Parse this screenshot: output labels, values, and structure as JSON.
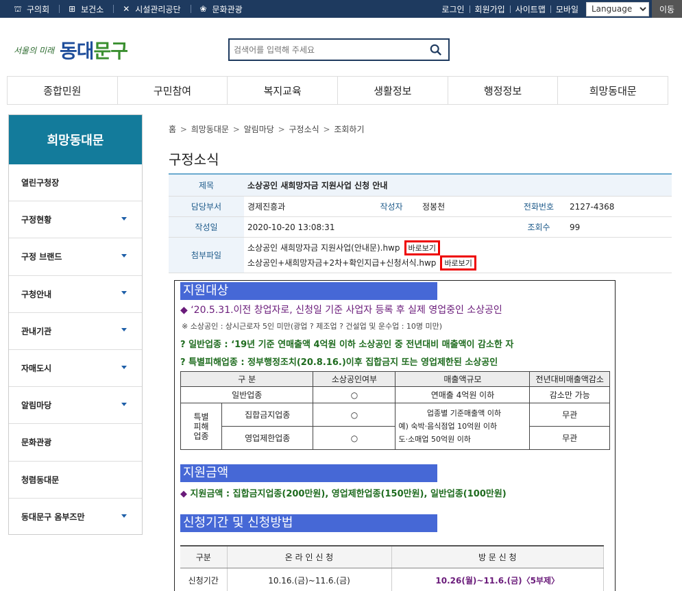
{
  "topbar": {
    "links": [
      {
        "icon": "council-icon",
        "label": "구의회"
      },
      {
        "icon": "health-center-icon",
        "label": "보건소"
      },
      {
        "icon": "facility-tools-icon",
        "label": "시설관리공단"
      },
      {
        "icon": "culture-hall-icon",
        "label": "문화관광"
      }
    ],
    "right_links": [
      "로그인",
      "회원가입",
      "사이트맵",
      "모바일"
    ],
    "language_select": "Language",
    "go_button": "이동"
  },
  "logo": {
    "small": "서울의 미래",
    "big_1": "동대",
    "big_2": "문구"
  },
  "search": {
    "placeholder": "검색어를 입력해 주세요"
  },
  "gnb": [
    "종합민원",
    "구민참여",
    "복지교육",
    "생활정보",
    "행정정보",
    "희망동대문"
  ],
  "lnb": {
    "title": "희망동대문",
    "items": [
      {
        "label": "열린구청장",
        "arrow": false
      },
      {
        "label": "구정현황",
        "arrow": true
      },
      {
        "label": "구정 브랜드",
        "arrow": true
      },
      {
        "label": "구청안내",
        "arrow": true
      },
      {
        "label": "관내기관",
        "arrow": true
      },
      {
        "label": "자매도시",
        "arrow": true
      },
      {
        "label": "알림마당",
        "arrow": true
      },
      {
        "label": "문화관광",
        "arrow": false
      },
      {
        "label": "청렴동대문",
        "arrow": false
      },
      {
        "label": "동대문구 옴부즈만",
        "arrow": true
      }
    ]
  },
  "breadcrumb": [
    "홈",
    "희망동대문",
    "알림마당",
    "구정소식",
    "조회하기"
  ],
  "page_title": "구정소식",
  "post": {
    "title_label": "제목",
    "title": "소상공인 새희망자금 지원사업 신청 안내",
    "dept_label": "담당부서",
    "dept": "경제진흥과",
    "author_label": "작성자",
    "author": "정봉천",
    "phone_label": "전화번호",
    "phone": "2127-4368",
    "date_label": "작성일",
    "date": "2020-10-20 13:08:31",
    "views_label": "조회수",
    "views": "99",
    "files_label": "첨부파일",
    "files": [
      {
        "name": "소상공인 새희망자금 지원사업(안내문).hwp",
        "view": "바로보기"
      },
      {
        "name": "소상공인+새희망자금+2차+확인지급+신청서식.hwp",
        "view": "바로보기"
      }
    ]
  },
  "doc": {
    "sec1": "지원대상",
    "bullet1": "◆ ‘20.5.31.이전 창업자로, 신청일 기준 사업자 등록 후 실제 영업중인 소상공인",
    "note1": "※ 소상공인 : 상시근로자 5인 미만(광업 ? 제조업 ? 건설업 및 운수업 : 10명 미만)",
    "item1": "?  일반업종 : ‘19년 기준 연매출액 4억원 이하 소상공인 중 전년대비 매출액이 감소한 자",
    "item2": "?  특별피해업종 : 정부행정조치(20.8.16.)이후 집합금지 또는 영업제한된 소상공인",
    "table1": {
      "headers": [
        "구 분",
        "소상공인여부",
        "매출액규모",
        "전년대비매출액감소"
      ],
      "row1": [
        "일반업종",
        "○",
        "연매출 4억원 이하",
        "감소만 가능"
      ],
      "special_label": "특별\n피해\n업종",
      "row2_sub": "집합금지업종",
      "row2_check": "○",
      "row2_sales_1": "업종별 기준매출액 이하",
      "row2_sales_2": "예) 숙박·음식점업 10억원 이하",
      "row2_sales_3": "도·소매업 50억원 이하",
      "row2_decrease": "무관",
      "row3_sub": "영업제한업종",
      "row3_check": "○",
      "row3_decrease": "무관"
    },
    "sec2": "지원금액",
    "bullet2_mark": "◆ ",
    "bullet2": "지원금액 : 집합금지업종(200만원), 영업제한업종(150만원), 일반업종(100만원)",
    "sec3": "신청기간 및 신청방법",
    "table2": {
      "headers": [
        "구분",
        "온 라 인 신 청",
        "방 문 신 청"
      ],
      "row1": [
        "신청기간",
        "10.16.(금)~11.6.(금)",
        "10.26(월)~11.6.(금)〈5부제〉"
      ]
    }
  },
  "colors": {
    "topbar": "#1e3a5f",
    "lnb_head": "#137b9b",
    "section_bar": "#4668d6",
    "highlight_border": "#ee0000"
  }
}
